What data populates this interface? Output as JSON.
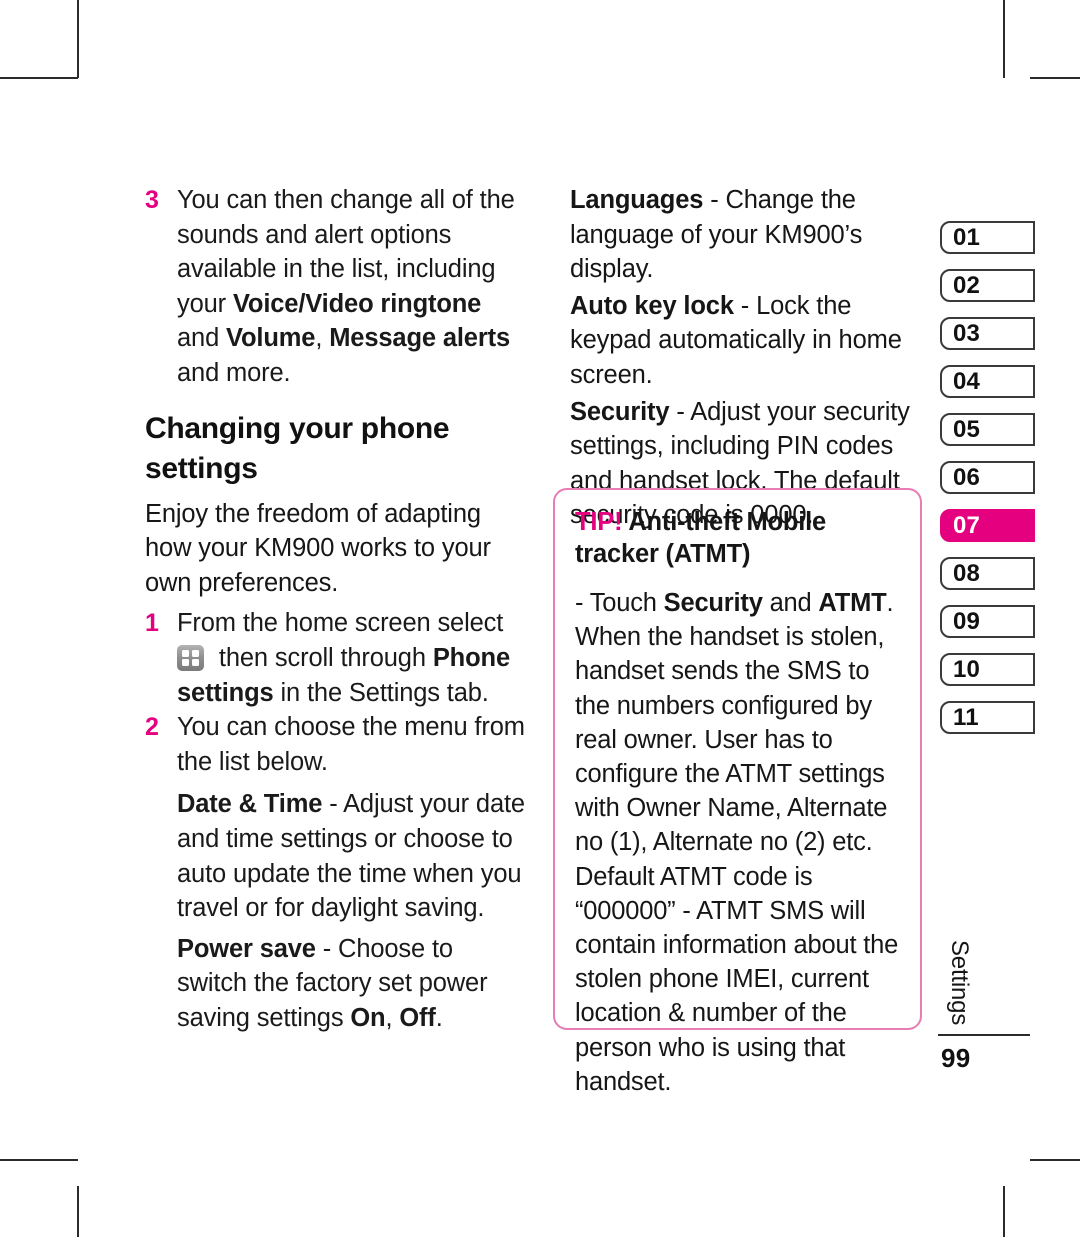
{
  "page": {
    "folio": "99",
    "section_label": "Settings",
    "accent_color": "#E4007F",
    "tip_border_color": "#E87CB4"
  },
  "left_column": {
    "step3": {
      "number": "3",
      "text_1": "You can then change all of the sounds and alert options available in the list, including your ",
      "bold_1": "Voice/Video ringtone",
      "text_2": " and ",
      "bold_2": "Volume",
      "text_3": ", ",
      "bold_3": "Message alerts",
      "text_4": " and more."
    },
    "section_title": "Changing your phone settings",
    "intro": "Enjoy the freedom of adapting how your KM900 works to your own preferences.",
    "step1": {
      "number": "1",
      "text_1": "From the home screen select ",
      "icon": "grid-menu-icon",
      "text_2": " then scroll through ",
      "bold_1": "Phone settings",
      "text_3": " in the Settings tab."
    },
    "step2": {
      "number": "2",
      "text": "You can choose the menu from the list below."
    },
    "entries": [
      {
        "term": "Date & Time",
        "description": " - Adjust your date and time settings or choose to auto update the time when you travel or for daylight saving."
      },
      {
        "term": "Power save",
        "description_1": " - Choose to switch the factory set power saving settings ",
        "bold_1": "On",
        "description_2": ", ",
        "bold_2": "Off",
        "description_3": "."
      }
    ]
  },
  "right_column": {
    "entries": [
      {
        "term": "Languages",
        "description": " - Change the language of your KM900’s display."
      },
      {
        "term": "Auto key lock",
        "description": " - Lock the keypad automatically in home screen."
      },
      {
        "term": "Security",
        "description": " - Adjust your security settings, including PIN codes and handset lock. The default security code is 0000."
      }
    ],
    "tip": {
      "label": "TIP!",
      "title": " Anti-theft Mobile tracker (ATMT)",
      "body_1": "- Touch ",
      "body_bold_1": "Security",
      "body_2": " and ",
      "body_bold_2": "ATMT",
      "body_3": ". When the handset is stolen, handset sends the SMS to the numbers configured by real owner. User has to configure the ATMT settings with Owner Name, Alternate no (1), Alternate no (2) etc. Default ATMT code is “000000” - ATMT SMS will contain information about the stolen phone IMEI, current location & number of the person who is using that handset."
    }
  },
  "tab_rail": {
    "tabs": [
      {
        "label": "01",
        "active": false
      },
      {
        "label": "02",
        "active": false
      },
      {
        "label": "03",
        "active": false
      },
      {
        "label": "04",
        "active": false
      },
      {
        "label": "05",
        "active": false
      },
      {
        "label": "06",
        "active": false
      },
      {
        "label": "07",
        "active": true
      },
      {
        "label": "08",
        "active": false
      },
      {
        "label": "09",
        "active": false
      },
      {
        "label": "10",
        "active": false
      },
      {
        "label": "11",
        "active": false
      }
    ]
  }
}
